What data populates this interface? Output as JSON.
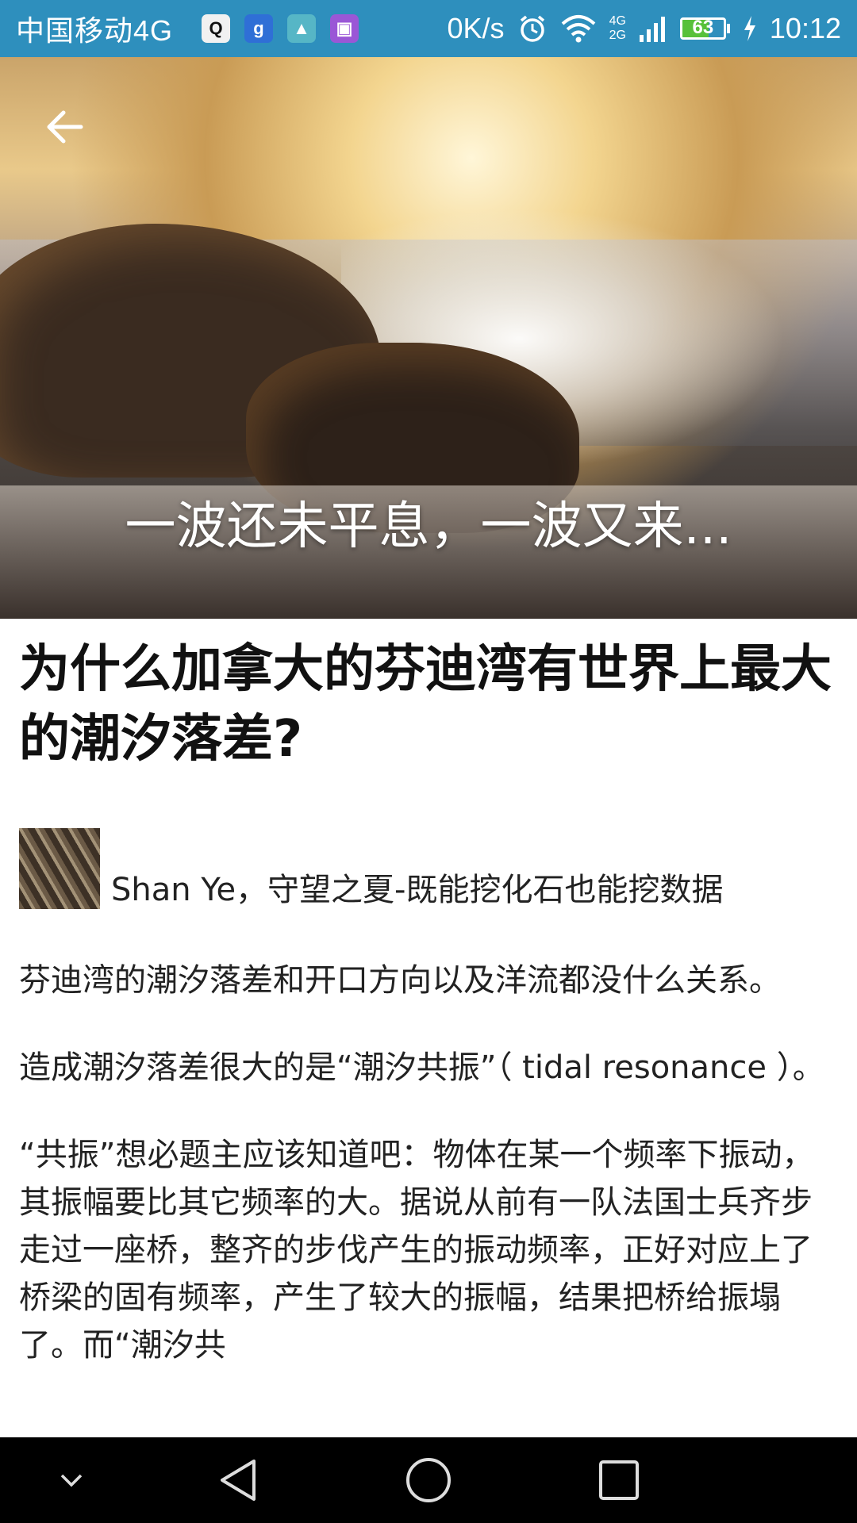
{
  "status_bar": {
    "carrier": "中国移动4G",
    "notifications": [
      {
        "icon": "qq-penguin-icon",
        "glyph": "🐧",
        "color": "#1a1a1a"
      },
      {
        "icon": "google-g-icon",
        "glyph": "g",
        "color": "#2f6fd6"
      },
      {
        "icon": "android-icon",
        "glyph": "▲",
        "color": "#56b6c6"
      },
      {
        "icon": "gallery-icon",
        "glyph": "▣",
        "color": "#9a57d6"
      }
    ],
    "net_speed": "0K/s",
    "net_type_top": "4G",
    "net_type_bottom": "2G",
    "battery_level": "63",
    "battery_fraction": 0.63,
    "time": "10:12"
  },
  "hero": {
    "caption": "一波还未平息，一波又来..."
  },
  "article": {
    "title": "为什么加拿大的芬迪湾有世界上最大的潮汐落差?",
    "author": "Shan Ye，守望之夏-既能挖化石也能挖数据",
    "paragraphs": [
      "芬迪湾的潮汐落差和开口方向以及洋流都没什么关系。",
      "造成潮汐落差很大的是“潮汐共振”（ tidal resonance ）。",
      "“共振”想必题主应该知道吧：物体在某一个频率下振动，其振幅要比其它频率的大。据说从前有一队法国士兵齐步走过一座桥，整齐的步伐产生的振动频率，正好对应上了桥梁的固有频率，产生了较大的振幅，结果把桥给振塌了。而“潮汐共"
    ]
  },
  "colors": {
    "status_bar": "#2e8fbd",
    "battery_fill": "#57c13a",
    "nav_bar": "#000000"
  }
}
